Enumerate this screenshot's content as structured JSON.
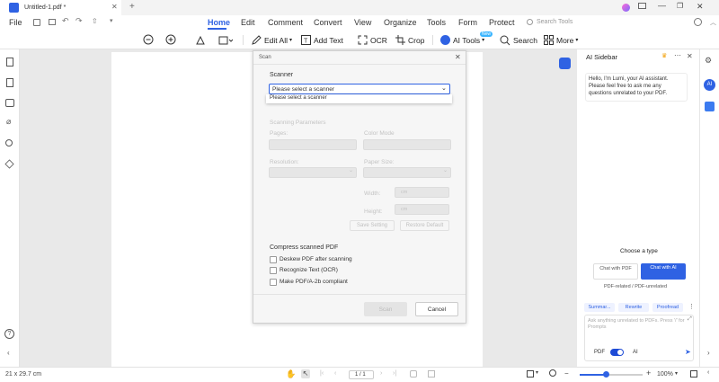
{
  "titlebar": {
    "doc_tab": "Untitled-1.pdf *"
  },
  "menubar": {
    "file": "File",
    "tabs": [
      "Home",
      "Edit",
      "Comment",
      "Convert",
      "View",
      "Organize",
      "Tools",
      "Form",
      "Protect"
    ],
    "search_placeholder": "Search Tools"
  },
  "ribbon": {
    "edit_all": "Edit All",
    "add_text": "Add Text",
    "ocr": "OCR",
    "crop": "Crop",
    "ai_tools": "AI Tools",
    "ai_badge": "New",
    "search": "Search",
    "more": "More"
  },
  "dialog": {
    "title": "Scan",
    "scanner_label": "Scanner",
    "scanner_value": "Please select a scanner",
    "dropdown_option": "Please select a scanner",
    "params_label": "Scanning Parameters",
    "pages_label": "Pages:",
    "color_label": "Color Mode",
    "resolution_label": "Resolution:",
    "paper_label": "Paper Size:",
    "width_label": "Width:",
    "width_unit": "cm",
    "height_label": "Height:",
    "height_unit": "cm",
    "save_setting": "Save Setting",
    "restore_default": "Restore Default",
    "compress_label": "Compress scanned PDF",
    "checkboxes": [
      "Deskew PDF after scanning",
      "Recognize Text (OCR)",
      "Make PDF/A-2b compliant"
    ],
    "scan_btn": "Scan",
    "cancel_btn": "Cancel"
  },
  "sidebar": {
    "title": "AI Sidebar",
    "greeting": "Hello, I'm Lumi, your AI assistant. Please feel free to ask me any questions unrelated to your PDF.",
    "choose_type": "Choose a type",
    "chat_pdf": "Chat with PDF",
    "chat_ai": "Chat with AI",
    "type_caption": "PDF-related / PDF-unrelated",
    "chips": [
      "Summar...",
      "Rewrite",
      "Proofread"
    ],
    "input_placeholder": "Ask anything unrelated to PDFs. Press '/' for Prompts",
    "pdf_toggle": "PDF",
    "ai_toggle": "AI"
  },
  "statusbar": {
    "page_size": "21 x 29.7 cm",
    "page_field": "1 / 1",
    "zoom": "100%"
  },
  "colors": {
    "accent": "#2f62e3",
    "toggle": "#1e4bd6"
  }
}
